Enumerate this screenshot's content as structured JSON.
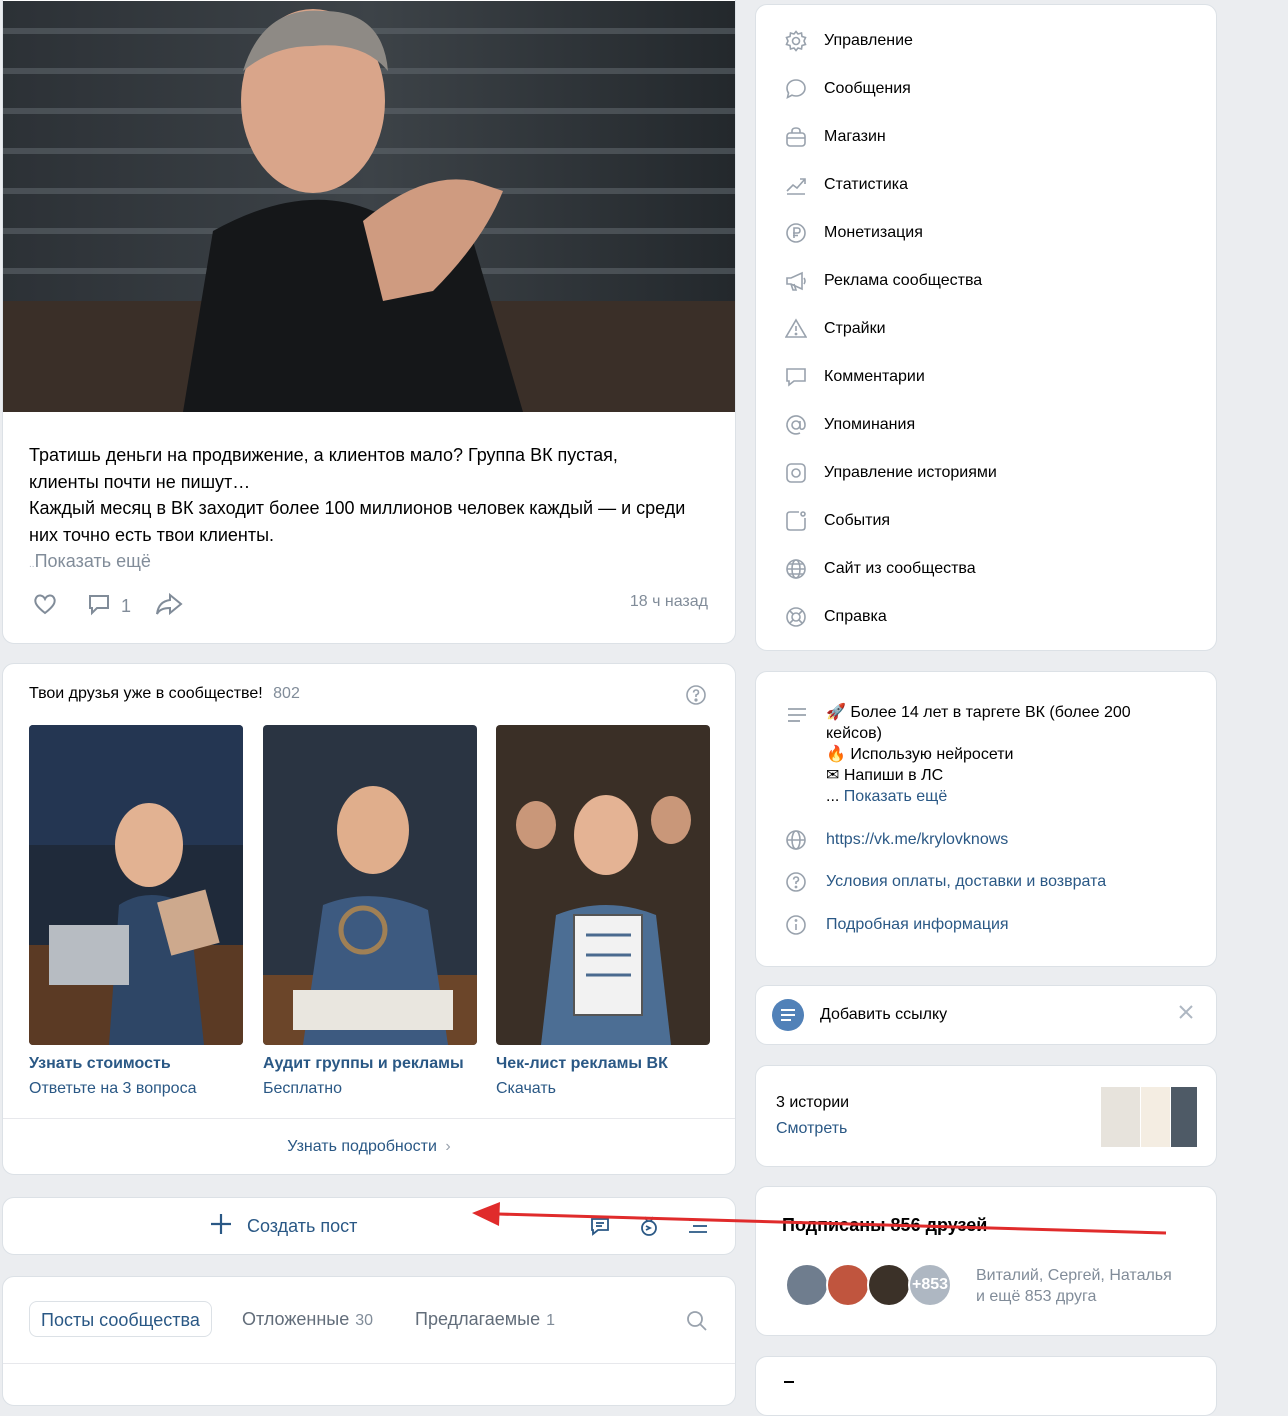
{
  "post": {
    "text": "Тратишь деньги на продвижение, а клиентов мало? Группа ВК пустая, клиенты почти не пишут…\nКаждый месяц в ВК заходит более 100 миллионов человек каждый — и среди них точно есть твои клиенты.",
    "show_more": "Показать ещё",
    "comments_count": "1",
    "time": "18 ч назад"
  },
  "friends_block": {
    "title": "Твои друзья уже в сообществе!",
    "count": "802",
    "tiles": [
      {
        "title": "Узнать стоимость",
        "subtitle": "Ответьте на 3 вопроса"
      },
      {
        "title": "Аудит группы и рекламы",
        "subtitle": "Бесплатно"
      },
      {
        "title": "Чек-лист рекламы ВК",
        "subtitle": "Скачать"
      }
    ],
    "more_label": "Узнать подробности"
  },
  "create_post": {
    "label": "Создать пост"
  },
  "tabs": [
    {
      "label": "Посты сообщества",
      "count": ""
    },
    {
      "label": "Отложенные",
      "count": "30"
    },
    {
      "label": "Предлагаемые",
      "count": "1"
    }
  ],
  "menu": [
    {
      "label": "Управление",
      "icon": "gear-icon"
    },
    {
      "label": "Сообщения",
      "icon": "message-icon"
    },
    {
      "label": "Магазин",
      "icon": "shop-icon"
    },
    {
      "label": "Статистика",
      "icon": "stats-icon"
    },
    {
      "label": "Монетизация",
      "icon": "ruble-icon"
    },
    {
      "label": "Реклама сообщества",
      "icon": "megaphone-icon"
    },
    {
      "label": "Страйки",
      "icon": "warning-icon"
    },
    {
      "label": "Комментарии",
      "icon": "comment-icon"
    },
    {
      "label": "Упоминания",
      "icon": "at-icon"
    },
    {
      "label": "Управление историями",
      "icon": "stories-icon"
    },
    {
      "label": "События",
      "icon": "events-icon"
    },
    {
      "label": "Сайт из сообщества",
      "icon": "globe-icon"
    },
    {
      "label": "Справка",
      "icon": "help-icon"
    }
  ],
  "info": {
    "desc_line1": "🚀 Более 14 лет в таргете ВК (более 200 кейсов)",
    "desc_line2": "🔥 Использую нейросети",
    "desc_line3": "✉ Напиши в ЛС",
    "ellipsis": "...",
    "show_more": "Показать ещё",
    "url": "https://vk.me/krylovknows",
    "terms": "Условия оплаты, доставки и возврата",
    "details": "Подробная информация"
  },
  "add_link": {
    "label": "Добавить ссылку"
  },
  "stories": {
    "title": "3 истории",
    "action": "Смотреть"
  },
  "subscribed": {
    "title": "Подписаны 856 друзей",
    "more_badge": "+853",
    "names": "Виталий, Сергей, Наталья",
    "rest": "и ещё 853 друга"
  },
  "colors": {
    "accent": "#2a5885",
    "annotation_arrow": "#e02b2b",
    "muted": "#818c99"
  }
}
